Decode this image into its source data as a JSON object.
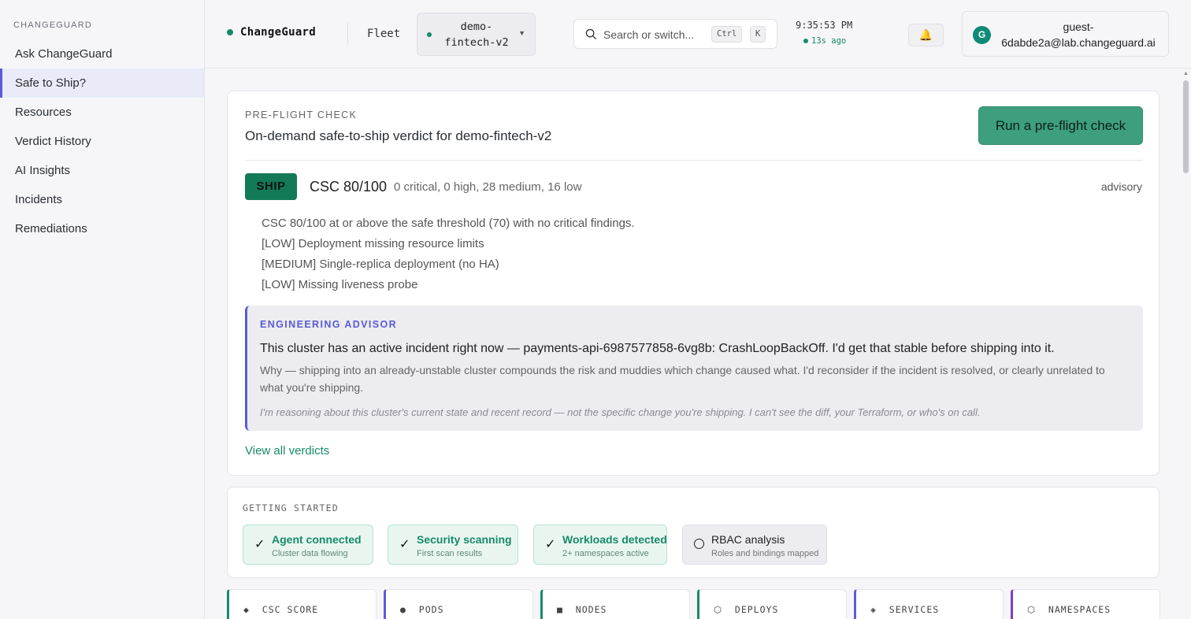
{
  "sidebar": {
    "brand": "CHANGEGUARD",
    "items": [
      {
        "label": "Ask ChangeGuard"
      },
      {
        "label": "Safe to Ship?"
      },
      {
        "label": "Resources"
      },
      {
        "label": "Verdict History"
      },
      {
        "label": "AI Insights"
      },
      {
        "label": "Incidents"
      },
      {
        "label": "Remediations"
      }
    ]
  },
  "header": {
    "logo": "ChangeGuard",
    "fleet": "Fleet",
    "cluster": "demo-\nfintech-v2",
    "search_placeholder": "Search or switch...",
    "kbd_ctrl": "Ctrl",
    "kbd_k": "K",
    "time": "9:35:53 PM",
    "updated": "13s ago",
    "avatar_initial": "G",
    "user_email": "guest-\n6dabde2a@lab.changeguard.ai"
  },
  "preflight": {
    "eyebrow": "PRE-FLIGHT CHECK",
    "subtitle": "On-demand safe-to-ship verdict for demo-fintech-v2",
    "run_button": "Run a pre-flight check",
    "verdict": "SHIP",
    "score": "CSC 80/100",
    "counts": "0 critical, 0 high, 28 medium, 16 low",
    "mode": "advisory",
    "findings": [
      "CSC 80/100 at or above the safe threshold (70) with no critical findings.",
      "[LOW] Deployment missing resource limits",
      "[MEDIUM] Single-replica deployment (no HA)",
      "[LOW] Missing liveness probe"
    ],
    "advisor": {
      "eyebrow": "ENGINEERING ADVISOR",
      "headline": "This cluster has an active incident right now — payments-api-6987577858-6vg8b: CrashLoopBackOff. I'd get that stable before shipping into it.",
      "why": "Why — shipping into an already-unstable cluster compounds the risk and muddies which change caused what. I'd reconsider if the incident is resolved, or clearly unrelated to what you're shipping.",
      "note": "I'm reasoning about this cluster's current state and recent record — not the specific change you're shipping. I can't see the diff, your Terraform, or who's on call."
    },
    "view_all": "View all verdicts"
  },
  "getting_started": {
    "eyebrow": "GETTING STARTED",
    "steps": [
      {
        "title": "Agent connected",
        "desc": "Cluster data flowing",
        "done": true
      },
      {
        "title": "Security scanning",
        "desc": "First scan results",
        "done": true
      },
      {
        "title": "Workloads detected",
        "desc": "2+ namespaces active",
        "done": true
      },
      {
        "title": "RBAC analysis",
        "desc": "Roles and bindings mapped",
        "done": false
      }
    ]
  },
  "metrics": [
    {
      "icon": "◆",
      "label": "CSC SCORE",
      "color": "#178a6b"
    },
    {
      "icon": "●",
      "label": "PODS",
      "color": "#5b5bd6"
    },
    {
      "icon": "■",
      "label": "NODES",
      "color": "#178a6b"
    },
    {
      "icon": "⬡",
      "label": "DEPLOYS",
      "color": "#178a6b"
    },
    {
      "icon": "◈",
      "label": "SERVICES",
      "color": "#5b5bd6"
    },
    {
      "icon": "⬡",
      "label": "NAMESPACES",
      "color": "#7b3fc8"
    }
  ],
  "colors": {
    "accent": "#5b5bd6",
    "success": "#178a6b"
  }
}
